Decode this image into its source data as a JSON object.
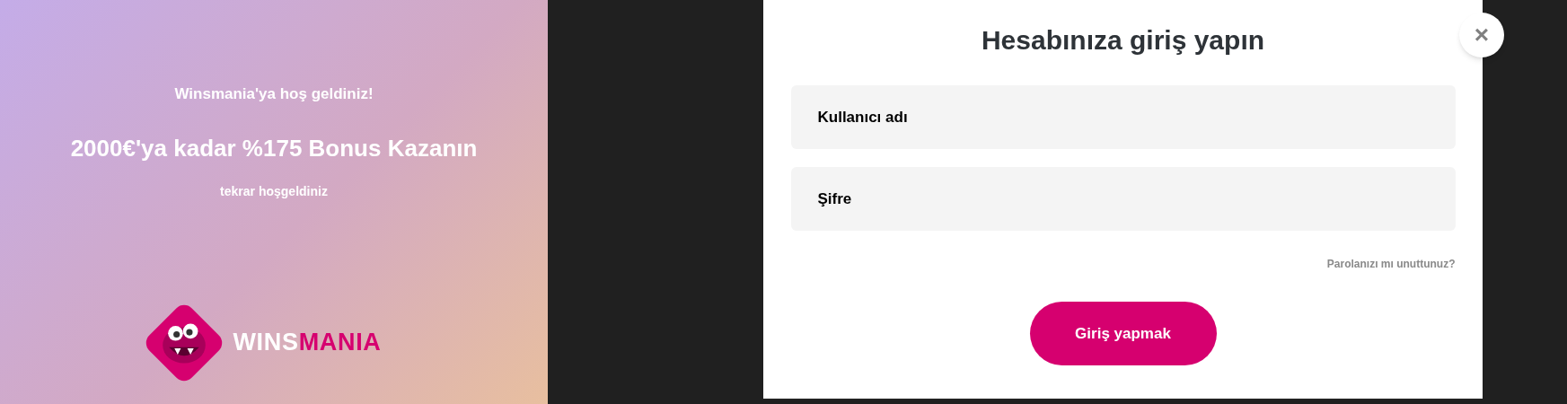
{
  "promo": {
    "welcome": "Winsmania'ya hoş geldiniz!",
    "headline": "2000€'ya kadar %175 Bonus Kazanın",
    "subtitle": "tekrar hoşgeldiniz"
  },
  "logo": {
    "light_part": "WINS",
    "brand_part": "MANIA"
  },
  "login": {
    "title": "Hesabınıza giriş yapın",
    "fields": [
      {
        "placeholder": "Kullanıcı adı"
      },
      {
        "placeholder": "Şifre"
      }
    ],
    "forgot_link": "Parolanızı mı unuttunuz?",
    "submit": "Giriş yapmak",
    "close": "×"
  }
}
